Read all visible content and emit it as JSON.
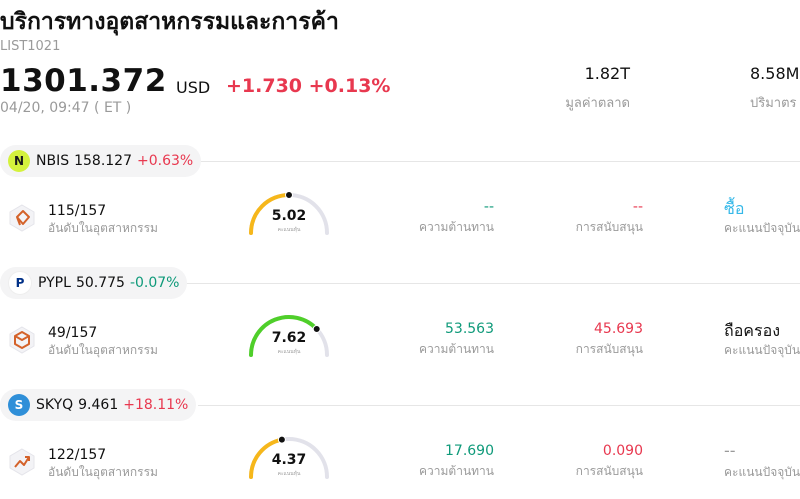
{
  "header": {
    "title": "บริการทางอุตสาหกรรมและการค้า",
    "code": "LIST1021",
    "price": "1301.372",
    "currency": "USD",
    "change": "+1.730 +0.13%",
    "time": "04/20, 09:47  ( ET )",
    "stats": [
      {
        "value": "1.82T",
        "label": "มูลค่าตลาด"
      },
      {
        "value": "8.58M",
        "label": "ปริมาตร"
      }
    ]
  },
  "stocks": [
    {
      "symbol": "NBIS",
      "price": "158.127",
      "pct": "+0.63%",
      "direction": "up",
      "logo_bg": "#d4f23c",
      "logo_fg": "#1a1a1a",
      "logo_text": "N",
      "rank": "115/157",
      "rank_label": "อันดับในอุตสาหกรรม",
      "score": "5.02",
      "score_fraction": 0.5,
      "score_label": "คะแนนหุ้น",
      "gauge_color": "#f6b71b",
      "resistance": "--",
      "resistance_label": "ความต้านทาน",
      "support": "--",
      "support_label": "การสนับสนุน",
      "rating": "ซื้อ",
      "rating_label": "คะแนนปัจจุบัน",
      "rating_color": "#35b8e8",
      "rank_icon": "diamond-rank-icon",
      "rank_color": "#d4622a"
    },
    {
      "symbol": "PYPL",
      "price": "50.775",
      "pct": "-0.07%",
      "direction": "down",
      "logo_bg": "#ffffff",
      "logo_fg": "#003087",
      "logo_text": "P",
      "rank": "49/157",
      "rank_label": "อันดับในอุตสาหกรรม",
      "score": "7.62",
      "score_fraction": 0.76,
      "score_label": "คะแนนหุ้น",
      "gauge_color": "#4fcf2a",
      "resistance": "53.563",
      "resistance_label": "ความต้านทาน",
      "support": "45.693",
      "support_label": "การสนับสนุน",
      "rating": "ถือครอง",
      "rating_label": "คะแนนปัจจุบัน",
      "rating_color": "#111111",
      "rank_icon": "hexagon-rank-icon",
      "rank_color": "#d4622a"
    },
    {
      "symbol": "SKYQ",
      "price": "9.461",
      "pct": "+18.11%",
      "direction": "up",
      "logo_bg": "#2f8fd8",
      "logo_fg": "#ffffff",
      "logo_text": "S",
      "rank": "122/157",
      "rank_label": "อันดับในอุตสาหกรรม",
      "score": "4.37",
      "score_fraction": 0.44,
      "score_label": "คะแนนหุ้น",
      "gauge_color": "#f6b71b",
      "resistance": "17.690",
      "resistance_label": "ความต้านทาน",
      "support": "0.090",
      "support_label": "การสนับสนุน",
      "rating": "--",
      "rating_label": "คะแนนปัจจุบัน",
      "rating_color": "#9a9a9a",
      "rank_icon": "trend-rank-icon",
      "rank_color": "#d4622a"
    }
  ],
  "colors": {
    "up": "#e8384f",
    "down": "#0f9a7a",
    "gauge_track": "#e2e2ea"
  }
}
